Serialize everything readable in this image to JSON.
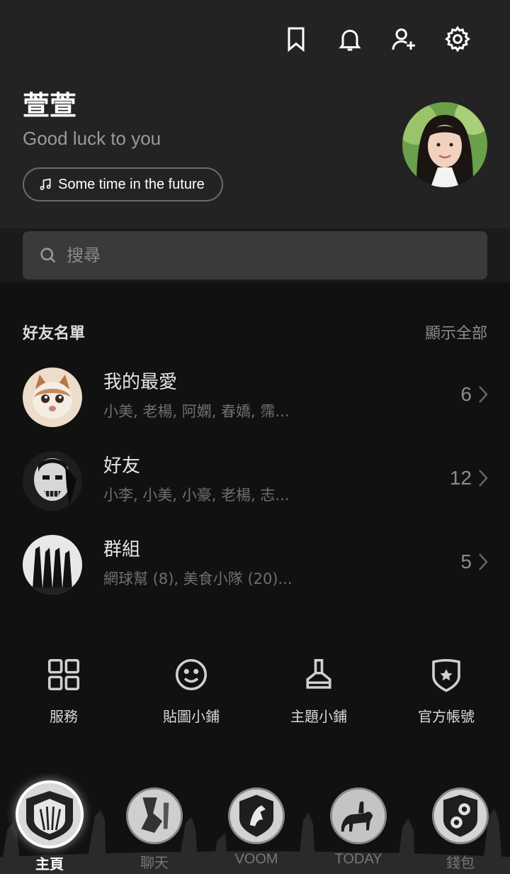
{
  "profile": {
    "name": "萱萱",
    "status": "Good luck to you",
    "music": "Some time in the future"
  },
  "search": {
    "placeholder": "搜尋"
  },
  "friends_section": {
    "title": "好友名單",
    "show_all": "顯示全部",
    "rows": [
      {
        "name": "我的最愛",
        "members": "小美, 老楊, 阿嫻, 春嬌, 霈...",
        "count": "6"
      },
      {
        "name": "好友",
        "members": "小李, 小美, 小豪, 老楊, 志...",
        "count": "12"
      },
      {
        "name": "群組",
        "members": "網球幫 (8), 美食小隊 (20)...",
        "count": "5"
      }
    ]
  },
  "quick_actions": [
    {
      "label": "服務",
      "icon": "grid-icon"
    },
    {
      "label": "貼圖小鋪",
      "icon": "smiley-icon"
    },
    {
      "label": "主題小鋪",
      "icon": "brush-icon"
    },
    {
      "label": "官方帳號",
      "icon": "shield-star-icon"
    }
  ],
  "tabs": [
    {
      "label": "主頁",
      "active": true
    },
    {
      "label": "聊天",
      "active": false
    },
    {
      "label": "VOOM",
      "active": false
    },
    {
      "label": "TODAY",
      "active": false
    },
    {
      "label": "錢包",
      "active": false
    }
  ],
  "top_icons": [
    "bookmark-icon",
    "bell-icon",
    "add-friend-icon",
    "gear-icon"
  ],
  "colors": {
    "background": "#111111",
    "header": "#232323",
    "search_bg": "#3a3a3a"
  }
}
